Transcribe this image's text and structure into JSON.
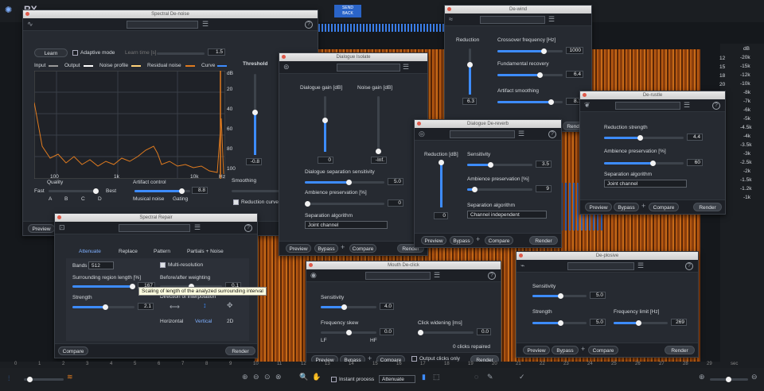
{
  "app": {
    "logo": "RX"
  },
  "top_tabs": [
    "SEND",
    "BACK"
  ],
  "ruler_right": [
    "dB",
    "-20k",
    "-15k",
    "-12k",
    "-10k",
    "-8k",
    "-7k",
    "-6k",
    "-5k",
    "-4.5k",
    "-4k",
    "-3.5k",
    "-3k",
    "-2.5k",
    "-2k",
    "-1.5k",
    "-1.2k",
    "-1k"
  ],
  "ruler_right_db": [
    "12",
    "15",
    "18",
    "20",
    "24",
    "30",
    "36",
    "42",
    "48"
  ],
  "spectral_denoise": {
    "title": "Spectral De-noise",
    "learn": "Learn",
    "adaptive": "Adaptive mode",
    "learn_time": "Learn time [s]",
    "learn_time_val": "1.5",
    "legend": [
      "Input",
      "Output",
      "Noise profile",
      "Residual noise",
      "Curve"
    ],
    "threshold": "Threshold",
    "db_ticks": [
      "dB",
      "20",
      "40",
      "60",
      "80",
      "100"
    ],
    "hz_ticks": [
      "100",
      "1k",
      "10k",
      "Hz"
    ],
    "quality": "Quality",
    "fast": "Fast",
    "best": "Best",
    "q_marks": [
      "A",
      "B",
      "C",
      "D"
    ],
    "artifact": "Artifact control",
    "artifact_val": "8.8",
    "musical": "Musical noise",
    "gating": "Gating",
    "smoothing": "Smoothing",
    "reduction_curve": "Reduction curve",
    "threshold_val": "-0.8",
    "threshold_val2": "1",
    "preview": "Preview",
    "noise_only": "Noise only",
    "threshold_level": 0.52
  },
  "spectral_repair": {
    "title": "Spectral Repair",
    "tabs": [
      "Attenuate",
      "Replace",
      "Pattern",
      "Partials + Noise"
    ],
    "bands": "Bands",
    "bands_val": "512",
    "multires": "Multi-resolution",
    "surround": "Surrounding region length [%]",
    "surround_val": "167",
    "before_after": "Before/after weighting",
    "before_after_val": "0.1",
    "strength": "Strength",
    "strength_val": "2.1",
    "direction": "Direction of interpolation",
    "dirs": [
      "Horizontal",
      "Vertical",
      "2D"
    ],
    "compare": "Compare",
    "render": "Render",
    "tooltip": "Scaling of length of the analyzed surrounding interval"
  },
  "dialogue_isolate": {
    "title": "Dialogue Isolate",
    "dialogue_gain": "Dialogue gain [dB]",
    "noise_gain": "Noise gain [dB]",
    "dg_val": "0",
    "ng_val": "-Inf.",
    "sep_sens": "Dialogue separation sensitivity",
    "sep_sens_val": "5.0",
    "amb": "Ambience preservation [%]",
    "amb_val": "0",
    "algo": "Separation algorithm",
    "algo_val": "Joint channel",
    "preview": "Preview",
    "bypass": "Bypass",
    "compare": "Compare",
    "render": "Render"
  },
  "de_wind": {
    "title": "De-wind",
    "reduction": "Reduction",
    "reduction_val": "6.3",
    "crossover": "Crossover frequency [Hz]",
    "crossover_val": "1000",
    "fundamental": "Fundamental recovery",
    "fundamental_val": "6.4",
    "artifact": "Artifact smoothing",
    "artifact_val": "8.1",
    "render": "Render"
  },
  "dialogue_dereverb": {
    "title": "Dialogue De-reverb",
    "reduction": "Reduction [dB]",
    "reduction_val": "0",
    "sensitivity": "Sensitivity",
    "sensitivity_val": "3.5",
    "amb": "Ambience preservation [%]",
    "amb_val": "9",
    "algo": "Separation algorithm",
    "algo_val": "Channel independent",
    "preview": "Preview",
    "bypass": "Bypass",
    "compare": "Compare",
    "render": "Render"
  },
  "de_rustle": {
    "title": "De-rustle",
    "reduction": "Reduction strength",
    "reduction_val": "4.4",
    "amb": "Ambience preservation [%]",
    "amb_val": "60",
    "algo": "Separation algorithm",
    "algo_val": "Joint channel",
    "preview": "Preview",
    "bypass": "Bypass",
    "compare": "Compare",
    "render": "Render"
  },
  "mouth_declick": {
    "title": "Mouth De-click",
    "sensitivity": "Sensitivity",
    "sensitivity_val": "4.0",
    "skew": "Frequency skew",
    "skew_val": "0.0",
    "lf": "LF",
    "hf": "HF",
    "widening": "Click widening [ms]",
    "widening_val": "0.0",
    "repaired": "0 clicks repaired",
    "preview": "Preview",
    "bypass": "Bypass",
    "compare": "Compare",
    "output_clicks": "Output clicks only",
    "render": "Render"
  },
  "de_plosive": {
    "title": "De-plosive",
    "sensitivity": "Sensitivity",
    "sensitivity_val": "5.0",
    "strength": "Strength",
    "strength_val": "5.0",
    "freq_limit": "Frequency limit [Hz]",
    "freq_limit_val": "269",
    "preview": "Preview",
    "bypass": "Bypass",
    "compare": "Compare",
    "render": "Render"
  },
  "toolbar": {
    "instant": "Instant process",
    "attenuate": "Attenuate",
    "sec": "sec"
  },
  "timeline": [
    "0",
    "1",
    "2",
    "3",
    "4",
    "5",
    "6",
    "7",
    "8",
    "9",
    "10",
    "11",
    "12",
    "13",
    "14",
    "15",
    "16",
    "17",
    "18",
    "19",
    "20",
    "21",
    "22",
    "23",
    "24",
    "25",
    "26",
    "27",
    "28",
    "29",
    "sec"
  ]
}
